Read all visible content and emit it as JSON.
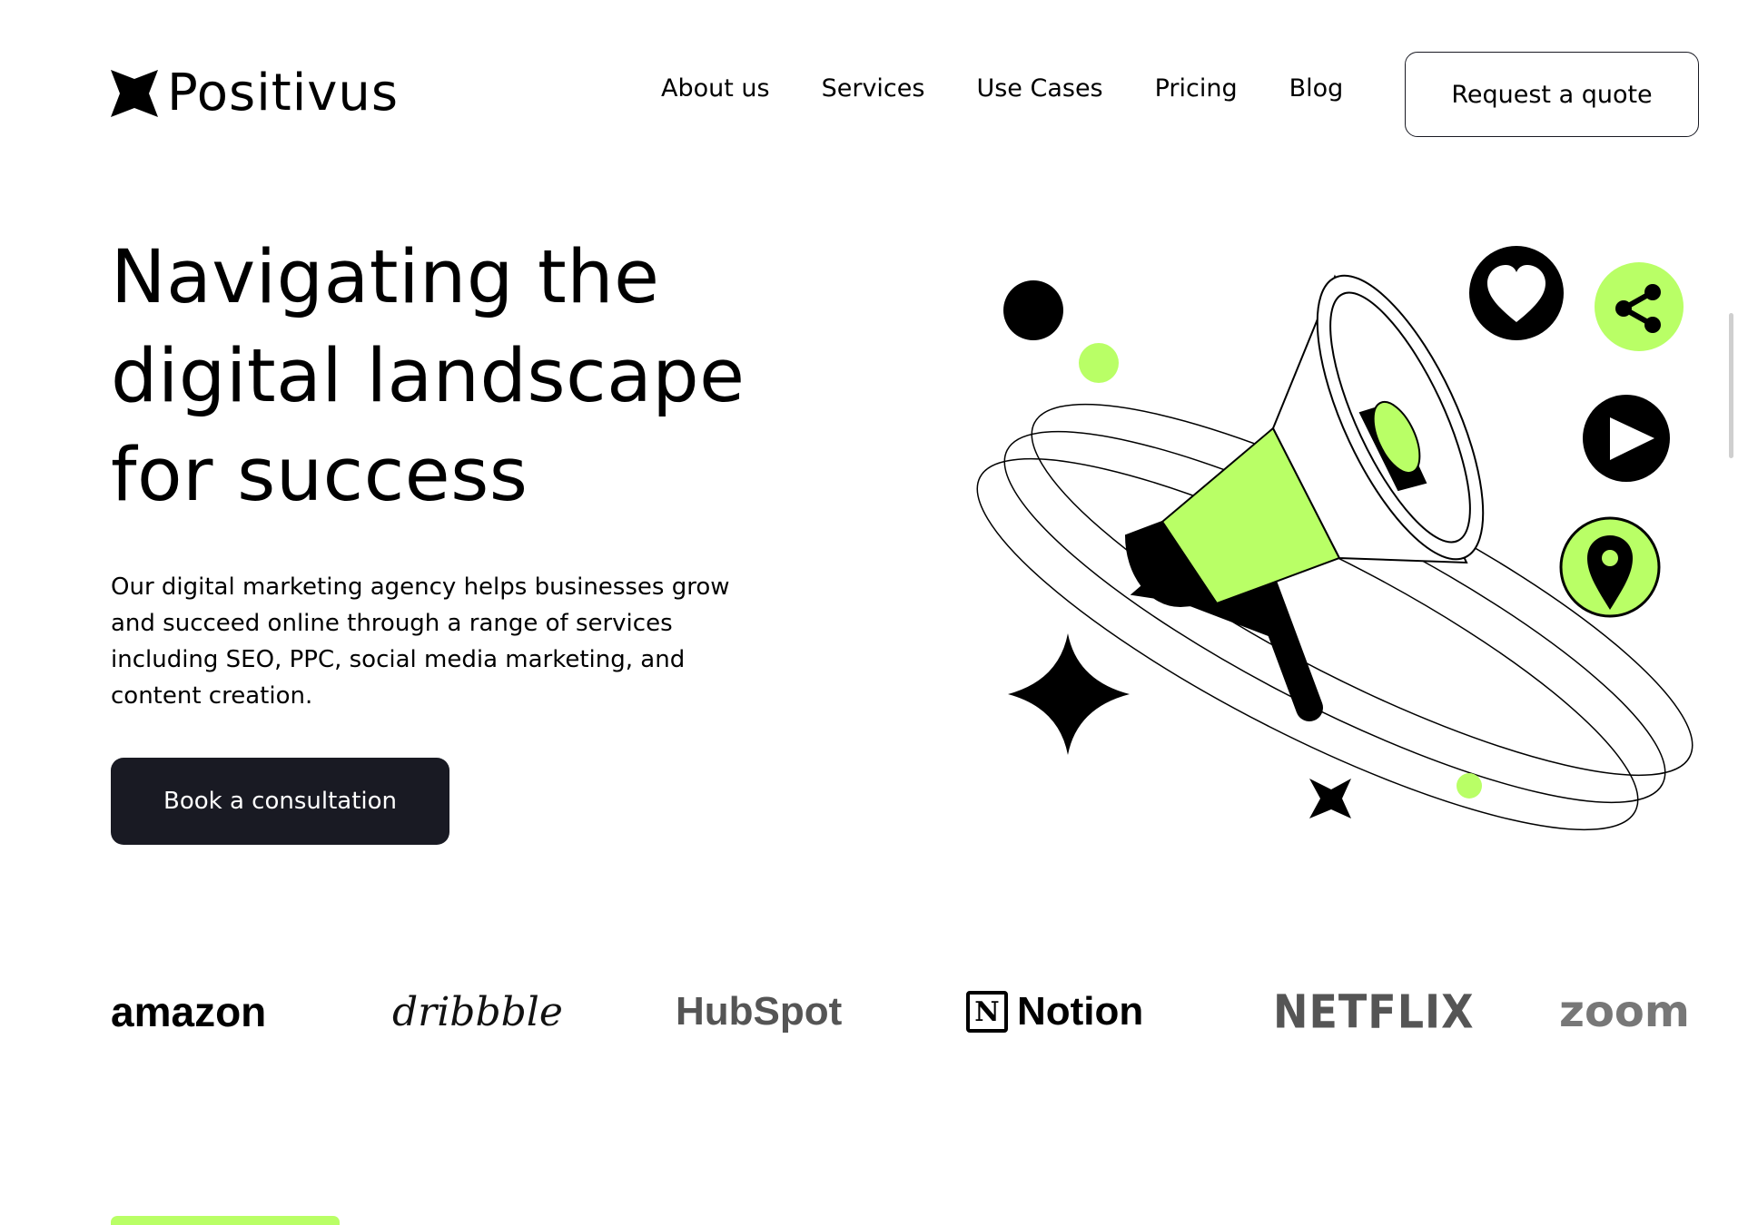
{
  "brand": {
    "name": "Positivus",
    "icon": "star-logo-icon"
  },
  "nav": {
    "items": [
      {
        "label": "About us"
      },
      {
        "label": "Services"
      },
      {
        "label": "Use Cases"
      },
      {
        "label": "Pricing"
      },
      {
        "label": "Blog"
      }
    ],
    "cta_label": "Request a quote"
  },
  "hero": {
    "title": "Navigating the digital landscape for success",
    "description": "Our digital marketing agency helps businesses grow and succeed online through a range of services including SEO, PPC, social media marketing, and content creation.",
    "cta_label": "Book a consultation",
    "illustration_icons": [
      "megaphone-icon",
      "heart-icon",
      "share-icon",
      "play-icon",
      "location-pin-icon",
      "sparkle-star-icon"
    ]
  },
  "clients": [
    {
      "name": "amazon"
    },
    {
      "name": "dribbble"
    },
    {
      "name": "HubSpot"
    },
    {
      "name": "Notion"
    },
    {
      "name": "NETFLIX"
    },
    {
      "name": "zoom"
    }
  ],
  "colors": {
    "accent": "#B9FF66",
    "dark": "#191A23",
    "text": "#000000",
    "background": "#FFFFFF"
  }
}
